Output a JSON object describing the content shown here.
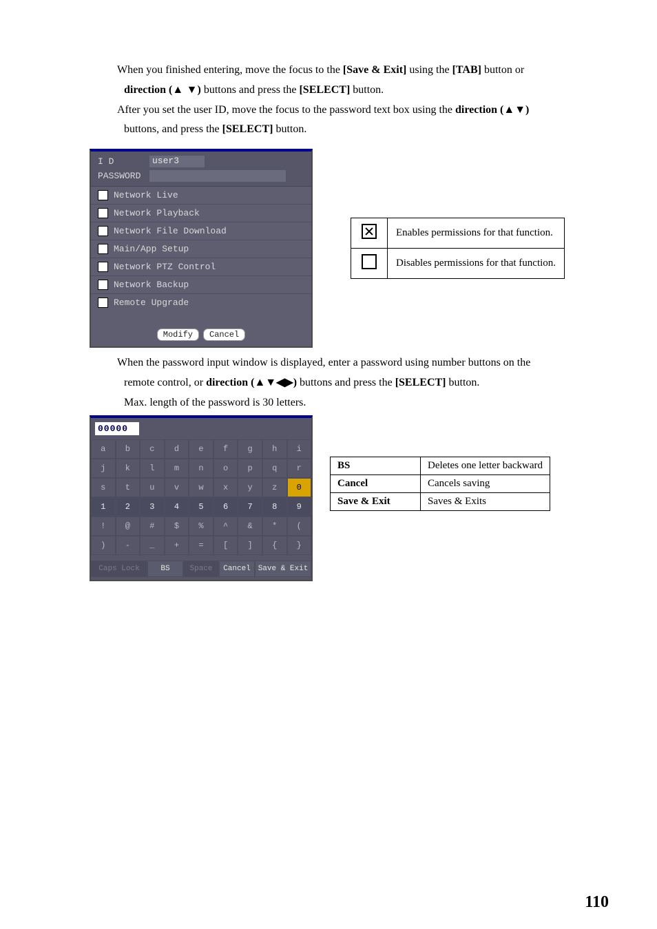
{
  "text": {
    "p1_a": "When you finished entering, move the focus to the ",
    "p1_b": "[Save & Exit]",
    "p1_c": " using the ",
    "p1_d": "[TAB]",
    "p1_e": " button or",
    "p2_a": " direction (",
    "p2_b": "▲ ▼",
    "p2_c": ")",
    "p2_d": " buttons and press the ",
    "p2_e": "[SELECT]",
    "p2_f": " button.",
    "p3_a": "After you set the user ID, move the focus to the password text box using the ",
    "p3_b": "direction (",
    "p3_c": "▲▼",
    "p3_d": ")",
    "p4_a": " buttons, and press the ",
    "p4_b": "[SELECT]",
    "p4_c": " button.",
    "p5_a": "When the password input window is displayed, enter a password using number buttons on the",
    "p6_a": " remote control, or ",
    "p6_b": "direction (",
    "p6_c": "▲▼◀▶",
    "p6_d": ")",
    "p6_e": " buttons and press the ",
    "p6_f": "[SELECT]",
    "p6_g": " button.",
    "p7": "Max. length of the password is 30 letters."
  },
  "dvr": {
    "id_label": "I     D",
    "pw_label": "PASSWORD",
    "id_value": "user3",
    "pw_value": "",
    "perms": [
      "Network Live",
      "Network Playback",
      "Network File Download",
      "Main/App Setup",
      "Network PTZ Control",
      "Network Backup",
      "Remote Upgrade"
    ],
    "btn_modify": "Modify",
    "btn_cancel": "Cancel"
  },
  "legend": {
    "enable": "Enables permissions for that function.",
    "disable": "Disables permissions for that function."
  },
  "osk": {
    "field": "00000",
    "rows": [
      [
        "a",
        "b",
        "c",
        "d",
        "e",
        "f",
        "g",
        "h",
        "i"
      ],
      [
        "j",
        "k",
        "l",
        "m",
        "n",
        "o",
        "p",
        "q",
        "r"
      ],
      [
        "s",
        "t",
        "u",
        "v",
        "w",
        "x",
        "y",
        "z",
        "0"
      ],
      [
        "1",
        "2",
        "3",
        "4",
        "5",
        "6",
        "7",
        "8",
        "9"
      ],
      [
        "!",
        "@",
        "#",
        "$",
        "%",
        "^",
        "&",
        "*",
        "("
      ],
      [
        ")",
        "-",
        "_",
        "+",
        "=",
        "[",
        "]",
        "{",
        "}"
      ]
    ],
    "bottom": [
      "Caps Lock",
      "BS",
      "Space",
      "Cancel",
      "Save & Exit"
    ]
  },
  "btn_table": {
    "rows": [
      [
        "BS",
        "Deletes one letter backward"
      ],
      [
        "Cancel",
        "Cancels saving"
      ],
      [
        "Save & Exit",
        "Saves & Exits"
      ]
    ]
  },
  "pageno": "110"
}
